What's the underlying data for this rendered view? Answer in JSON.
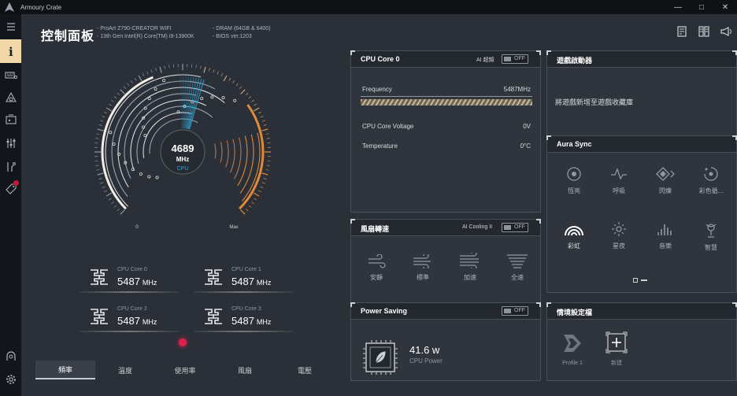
{
  "window": {
    "title": "Armoury Crate",
    "min": "—",
    "max": "□",
    "close": "✕"
  },
  "page": {
    "title": "控制面板",
    "sysinfo_left": [
      "ProArt Z790-CREATOR WIFI",
      "13th Gen Intel(R) Core(TM) i9-13900K"
    ],
    "sysinfo_right": [
      "DRAM (64GB & 6400)",
      "BIOS ver.1203"
    ]
  },
  "gauge": {
    "value": "4689",
    "unit": "MHz",
    "label": "CPU",
    "min_label": "0",
    "max_label": "Max",
    "fraction": 0.42,
    "accent_cool": "#2fa7d8",
    "accent_warm": "#e08a3a"
  },
  "cores": [
    {
      "label": "CPU Core 0",
      "value": "5487",
      "unit": "MHz"
    },
    {
      "label": "CPU Core 1",
      "value": "5487",
      "unit": "MHz"
    },
    {
      "label": "CPU Core 2",
      "value": "5487",
      "unit": "MHz"
    },
    {
      "label": "CPU Core 3",
      "value": "5487",
      "unit": "MHz"
    }
  ],
  "tabs": [
    "頻率",
    "溫度",
    "使用率",
    "風扇",
    "電壓"
  ],
  "cpu_panel": {
    "title": "CPU Core 0",
    "ai_label": "AI 超頻",
    "toggle": "OFF",
    "frequency_label": "Frequency",
    "frequency_value": "5487MHz",
    "voltage_label": "CPU Core Voltage",
    "voltage_value": "0V",
    "temp_label": "Temperature",
    "temp_value": "0°C"
  },
  "fan_panel": {
    "title": "風扇轉速",
    "ai_label": "AI Cooling II",
    "toggle": "OFF",
    "modes": [
      "安靜",
      "標準",
      "加速",
      "全速"
    ]
  },
  "power_panel": {
    "title": "Power Saving",
    "toggle": "OFF",
    "value": "41.6 w",
    "label": "CPU Power"
  },
  "game_panel": {
    "title": "遊戲啟動器",
    "text": "將遊戲新增至遊戲收藏庫"
  },
  "aura_panel": {
    "title": "Aura Sync",
    "effects": [
      "恆亮",
      "呼吸",
      "閃爍",
      "彩色循...",
      "彩虹",
      "星夜",
      "音樂",
      "智慧"
    ]
  },
  "scenario_panel": {
    "title": "情境設定檔",
    "profile_label": "Profile 1",
    "new_label": "新建"
  }
}
